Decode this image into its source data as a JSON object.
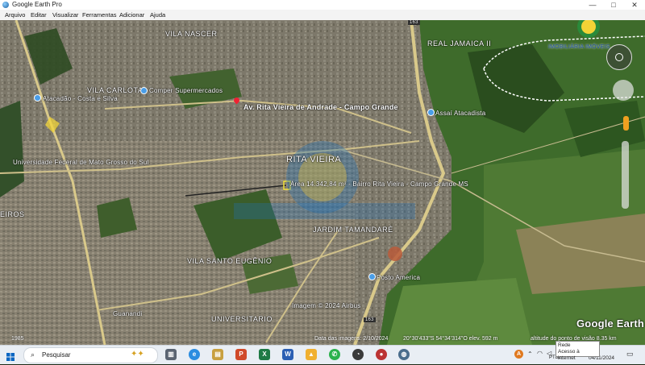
{
  "window": {
    "title": "Google Earth Pro",
    "controls": [
      "—",
      "□",
      "✕"
    ]
  },
  "menu": [
    "Arquivo",
    "Editar",
    "Visualizar",
    "Ferramentas",
    "Adicionar",
    "Ajuda"
  ],
  "map_labels": {
    "vila_nascer": "VILA NASCER",
    "real_jamaica": "REAL JAMAICA II",
    "vila_carlota": "VILA CARLOTA",
    "supermercados": "Comper Supermercados",
    "atacadao": "Atacadão - Costa e Silva",
    "avenida": "Av. Rita Vieira de Andrade - Campo Grande",
    "rita_vieira": "RITA VIEIRA",
    "area": "Área 14.342,84 m² - Bairro Rita Vieira - Campo Grande MS",
    "universidade": "Universidade Federal de Mato Grosso do Sul",
    "jardim": "JARDIM TAMANDARÉ",
    "vila_santo": "VILA SANTO EUGÊNIO",
    "posto": "Posto America",
    "universitario": "UNIVERSITARIO",
    "imagem": "Imagem © 2024 Airbus",
    "guanandi": "Guanandi",
    "eiros": "EIROS",
    "road_163": "163",
    "road_163b": "163",
    "costa": "Costa e Silva",
    "google_earth": "Google Earth",
    "watermark": "IMOBILIÁRIA IMÓVEIS",
    "atacado_rede": "Assaí Atacadista"
  },
  "status": {
    "year": "1985",
    "date": "Data das imagens: 2/10/2024",
    "coords": "20°30'433\"S  54°34'314\"O  elev.  592 m",
    "altitude": "altitude do ponto de visão  8.35 km"
  },
  "taskbar": {
    "search_placeholder": "Pesquisar",
    "tray_lang": "PTB2",
    "clock_time": "",
    "clock_date": "04/11/2024"
  },
  "tooltip": {
    "line1": "Rede",
    "line2": "Acesso à internet"
  },
  "colors": {
    "map_green": "#3f6a2c",
    "road": "#d9c98a",
    "urban": "#7a7566",
    "accent": "#4a9ee8"
  }
}
